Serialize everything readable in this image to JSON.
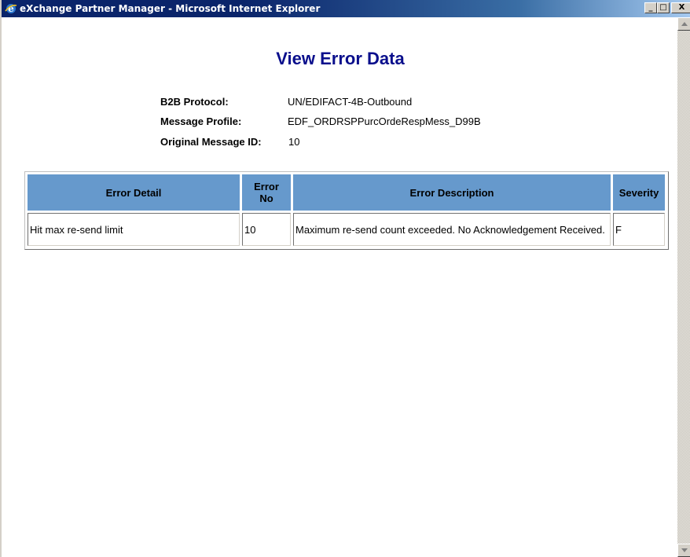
{
  "window": {
    "title": "eXchange Partner Manager - Microsoft Internet Explorer",
    "minimize_label": "_",
    "maximize_label": "□",
    "close_label": "X"
  },
  "page": {
    "title": "View Error Data"
  },
  "info": {
    "b2b_protocol_label": "B2B Protocol:",
    "b2b_protocol_value": "UN/EDIFACT-4B-Outbound",
    "message_profile_label": "Message Profile:",
    "message_profile_value": "EDF_ORDRSPPurcOrdeRespMess_D99B",
    "original_message_id_label": "Original Message ID:",
    "original_message_id_value": "10"
  },
  "table": {
    "headers": [
      "Error Detail",
      "Error No",
      "Error Description",
      "Severity"
    ],
    "rows": [
      [
        "Hit max re-send limit",
        "10",
        "Maximum re-send count exceeded. No Acknowledgement Received.",
        "F"
      ]
    ]
  },
  "colors": {
    "title_blue": "#0a0f8c",
    "header_blue": "#6699cc",
    "titlebar_dark": "#0a246a"
  },
  "icons": {
    "window_icon": "ie-logo-icon",
    "scroll_up": "arrow-up-icon",
    "scroll_down": "arrow-down-icon"
  }
}
